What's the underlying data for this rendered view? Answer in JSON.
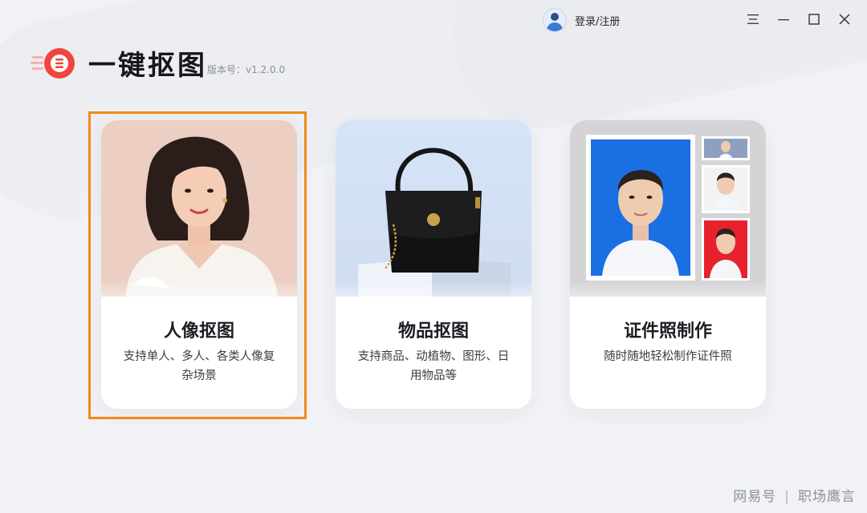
{
  "header": {
    "login_label": "登录/注册",
    "app_title": "一键抠图",
    "version": "版本号：v1.2.0.0"
  },
  "window_controls": [
    "menu-icon",
    "minimize-icon",
    "maximize-icon",
    "close-icon"
  ],
  "cards": [
    {
      "title": "人像抠图",
      "desc": "支持单人、多人、各类人像复杂场景",
      "selected": true
    },
    {
      "title": "物品抠图",
      "desc": "支持商品、动植物、图形、日用物品等",
      "selected": false
    },
    {
      "title": "证件照制作",
      "desc": "随时随地轻松制作证件照",
      "selected": false
    }
  ],
  "watermark": {
    "left": "网易号",
    "right": "职场鹰言"
  },
  "colors": {
    "highlight": "#f28a14",
    "logo_red": "#f0443c",
    "id_blue": "#1a6fe3",
    "id_red": "#e8222c"
  }
}
